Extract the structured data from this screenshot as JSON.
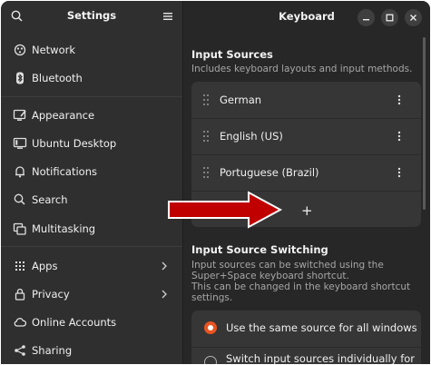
{
  "sidebar": {
    "title": "Settings",
    "items": [
      {
        "label": "Network",
        "icon": "network-icon"
      },
      {
        "label": "Bluetooth",
        "icon": "bluetooth-icon"
      },
      {
        "label": "Appearance",
        "icon": "appearance-icon"
      },
      {
        "label": "Ubuntu Desktop",
        "icon": "desktop-icon"
      },
      {
        "label": "Notifications",
        "icon": "bell-icon"
      },
      {
        "label": "Search",
        "icon": "search-icon"
      },
      {
        "label": "Multitasking",
        "icon": "multitasking-icon"
      },
      {
        "label": "Apps",
        "icon": "apps-grid-icon"
      },
      {
        "label": "Privacy",
        "icon": "lock-icon"
      },
      {
        "label": "Online Accounts",
        "icon": "cloud-icon"
      },
      {
        "label": "Sharing",
        "icon": "share-icon"
      }
    ]
  },
  "header": {
    "title": "Keyboard"
  },
  "input_sources": {
    "title": "Input Sources",
    "subtitle": "Includes keyboard layouts and input methods.",
    "sources": [
      "German",
      "English (US)",
      "Portuguese (Brazil)"
    ],
    "add_label": "+"
  },
  "switching": {
    "title": "Input Source Switching",
    "subtitle_lines": [
      "Input sources can be switched using the",
      "Super+Space keyboard shortcut.",
      "This can be changed in the keyboard shortcut",
      "settings."
    ],
    "options": [
      {
        "label": "Use the same source for all windows",
        "selected": true
      },
      {
        "label": "Switch input sources individually for each",
        "selected": false
      }
    ]
  },
  "colors": {
    "accent": "#e95420",
    "annotation_arrow": "#c00000"
  }
}
